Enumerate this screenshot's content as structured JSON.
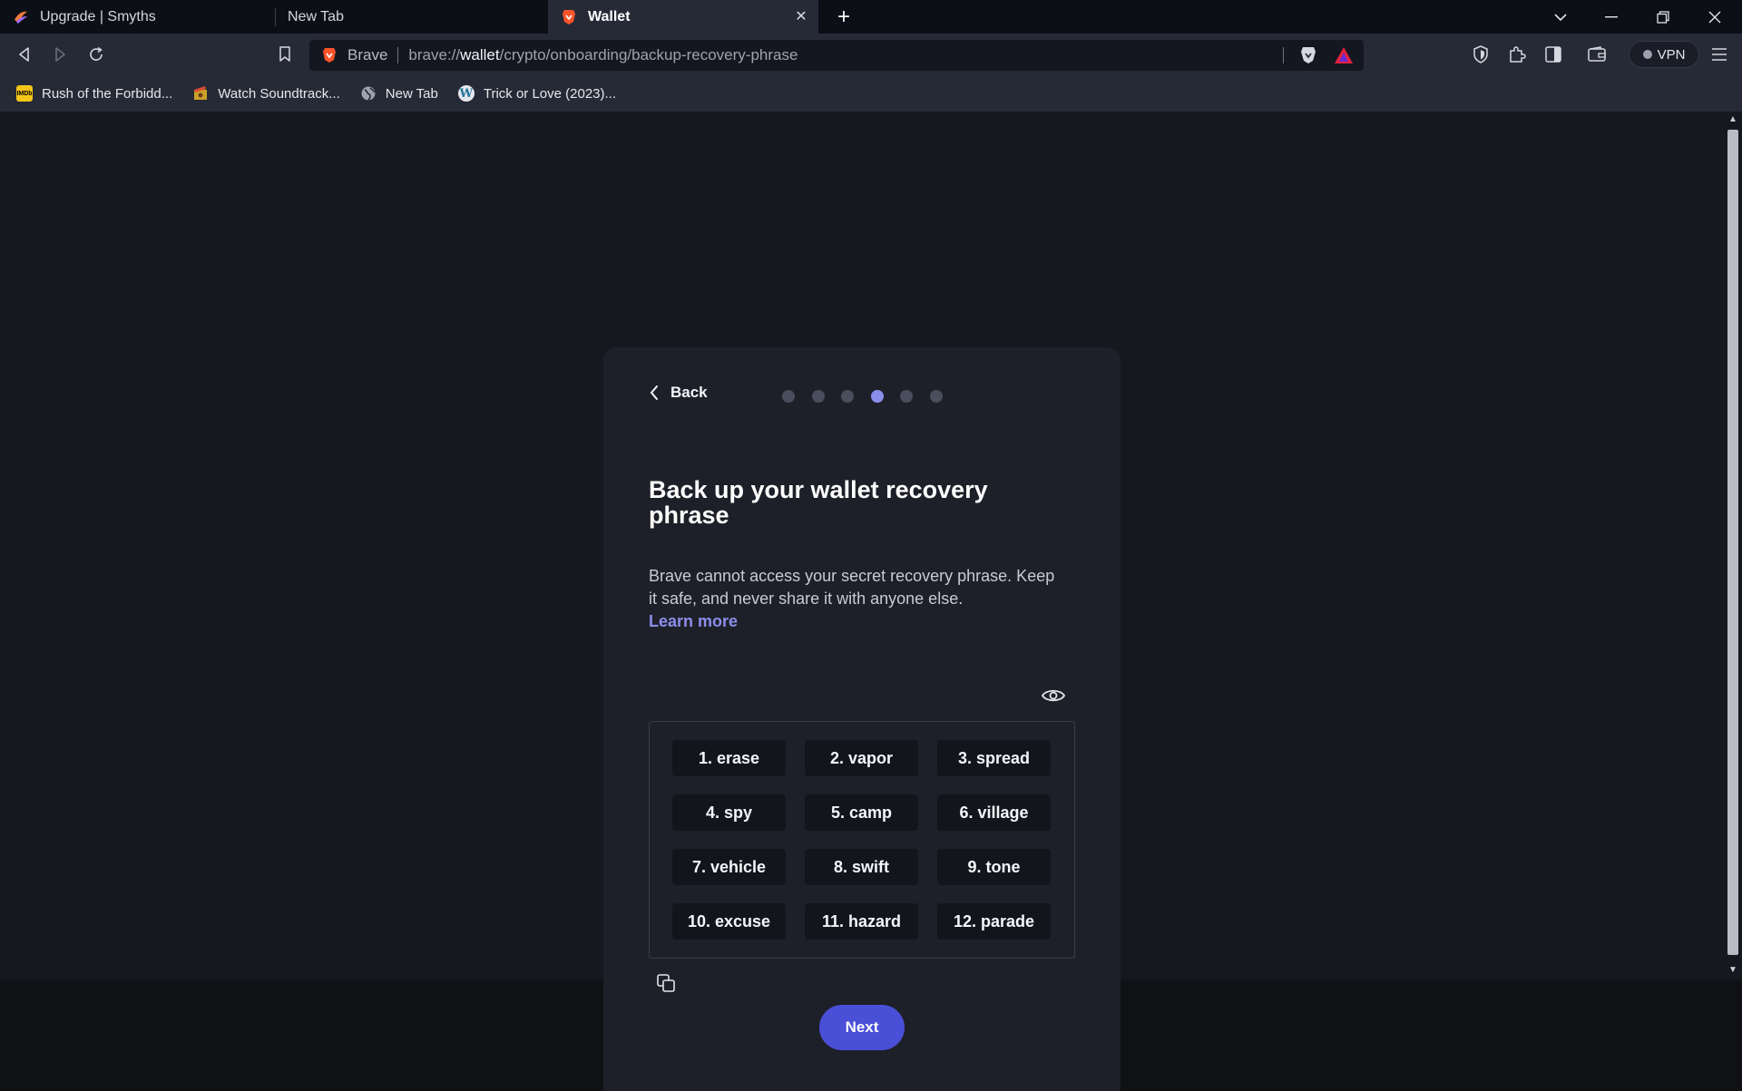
{
  "tabs": [
    {
      "title": "Upgrade | Smyths",
      "icon": "smyths-logo-icon",
      "active": false
    },
    {
      "title": "New Tab",
      "icon": "",
      "active": false
    },
    {
      "title": "Wallet",
      "icon": "brave-lion-icon",
      "active": true
    }
  ],
  "toolbar": {
    "site_name": "Brave",
    "url_prefix": "brave://",
    "url_host": "wallet",
    "url_path": "/crypto/onboarding/backup-recovery-phrase",
    "vpn_label": "VPN"
  },
  "bookmarks": [
    {
      "label": "Rush of the Forbidd...",
      "icon": "imdb-icon",
      "icon_text": "IMDb"
    },
    {
      "label": "Watch Soundtrack...",
      "icon": "film-icon",
      "icon_text": ""
    },
    {
      "label": "New Tab",
      "icon": "globe-icon",
      "icon_text": ""
    },
    {
      "label": "Trick or Love (2023)...",
      "icon": "wordpress-icon",
      "icon_text": "W"
    }
  ],
  "onboarding": {
    "back_label": "Back",
    "steps_total": 6,
    "active_step": 4,
    "title": "Back up your wallet recovery phrase",
    "description": "Brave cannot access your secret recovery phrase. Keep it safe, and never share it with anyone else.",
    "learn_more": "Learn more",
    "words": [
      "1. erase",
      "2. vapor",
      "3. spread",
      "4. spy",
      "5. camp",
      "6. village",
      "7. vehicle",
      "8. swift",
      "9. tone",
      "10. excuse",
      "11. hazard",
      "12. parade"
    ],
    "next_label": "Next"
  },
  "colors": {
    "accent": "#8b8eea",
    "button": "#4a4fd8",
    "card": "#1e2029",
    "page": "#16181f"
  }
}
